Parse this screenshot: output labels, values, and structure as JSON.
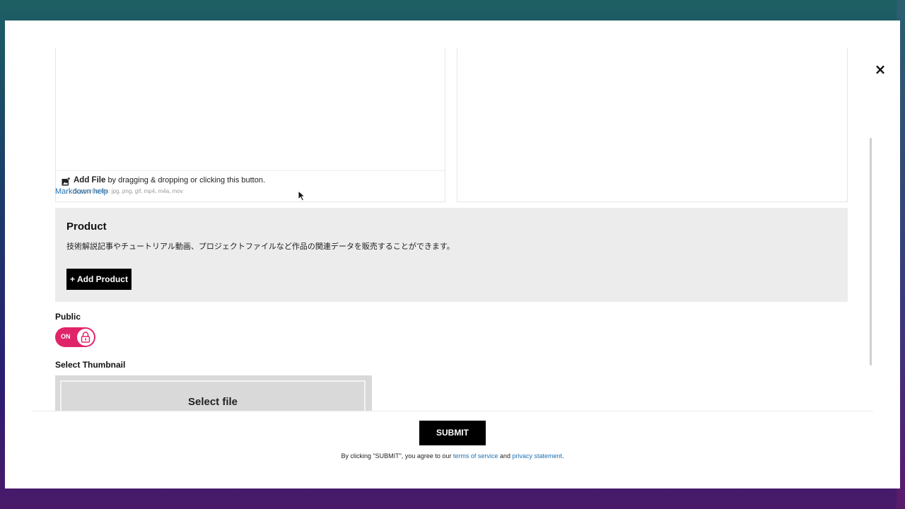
{
  "modal": {
    "close_label": "×"
  },
  "editor": {
    "add_file_label": "Add File",
    "add_file_hint": "by dragging & dropping or clicking this button.",
    "supported_files": "Supported file: jpg, png, gif, mp4, m4a, mov",
    "markdown_help": "Markdown help"
  },
  "product": {
    "title": "Product",
    "description": "技術解説記事やチュートリアル動画、プロジェクトファイルなど作品の関連データを販売することができます。",
    "add_button": "+ Add Product"
  },
  "visibility": {
    "label": "Public",
    "toggle_text": "ON",
    "toggle_state": "on",
    "toggle_color": "#e0246a"
  },
  "thumbnail": {
    "label": "Select Thumbnail",
    "button": "Select file"
  },
  "footer": {
    "submit": "SUBMIT",
    "agree_prefix": "By clicking \"SUBMIT\", you agree to our ",
    "terms": "terms of service",
    "and": " and ",
    "privacy": "privacy statement",
    "suffix": "."
  }
}
